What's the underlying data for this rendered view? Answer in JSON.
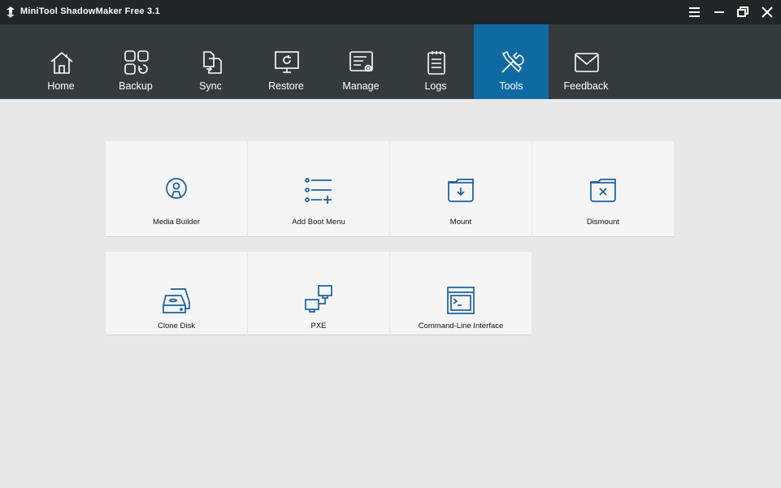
{
  "app": {
    "title": "MiniTool ShadowMaker Free 3.1"
  },
  "nav": [
    {
      "label": "Home",
      "icon": "home-icon"
    },
    {
      "label": "Backup",
      "icon": "backup-icon"
    },
    {
      "label": "Sync",
      "icon": "sync-icon"
    },
    {
      "label": "Restore",
      "icon": "restore-icon"
    },
    {
      "label": "Manage",
      "icon": "manage-icon"
    },
    {
      "label": "Logs",
      "icon": "logs-icon"
    },
    {
      "label": "Tools",
      "icon": "tools-icon",
      "active": true
    },
    {
      "label": "Feedback",
      "icon": "feedback-icon"
    }
  ],
  "tools": [
    {
      "label": "Media Builder",
      "icon": "media-builder-icon"
    },
    {
      "label": "Add Boot Menu",
      "icon": "add-boot-menu-icon"
    },
    {
      "label": "Mount",
      "icon": "mount-icon"
    },
    {
      "label": "Dismount",
      "icon": "dismount-icon"
    },
    {
      "label": "Clone Disk",
      "icon": "clone-disk-icon"
    },
    {
      "label": "PXE",
      "icon": "pxe-icon"
    },
    {
      "label": "Command-Line Interface",
      "icon": "command-line-icon"
    }
  ],
  "colors": {
    "titlebar": "#232526",
    "navbar": "#353a3d",
    "active_tab": "#0f6aa4",
    "icon_blue": "#1b5e9a",
    "background": "#e8e8e8",
    "tile": "#f5f5f5"
  }
}
